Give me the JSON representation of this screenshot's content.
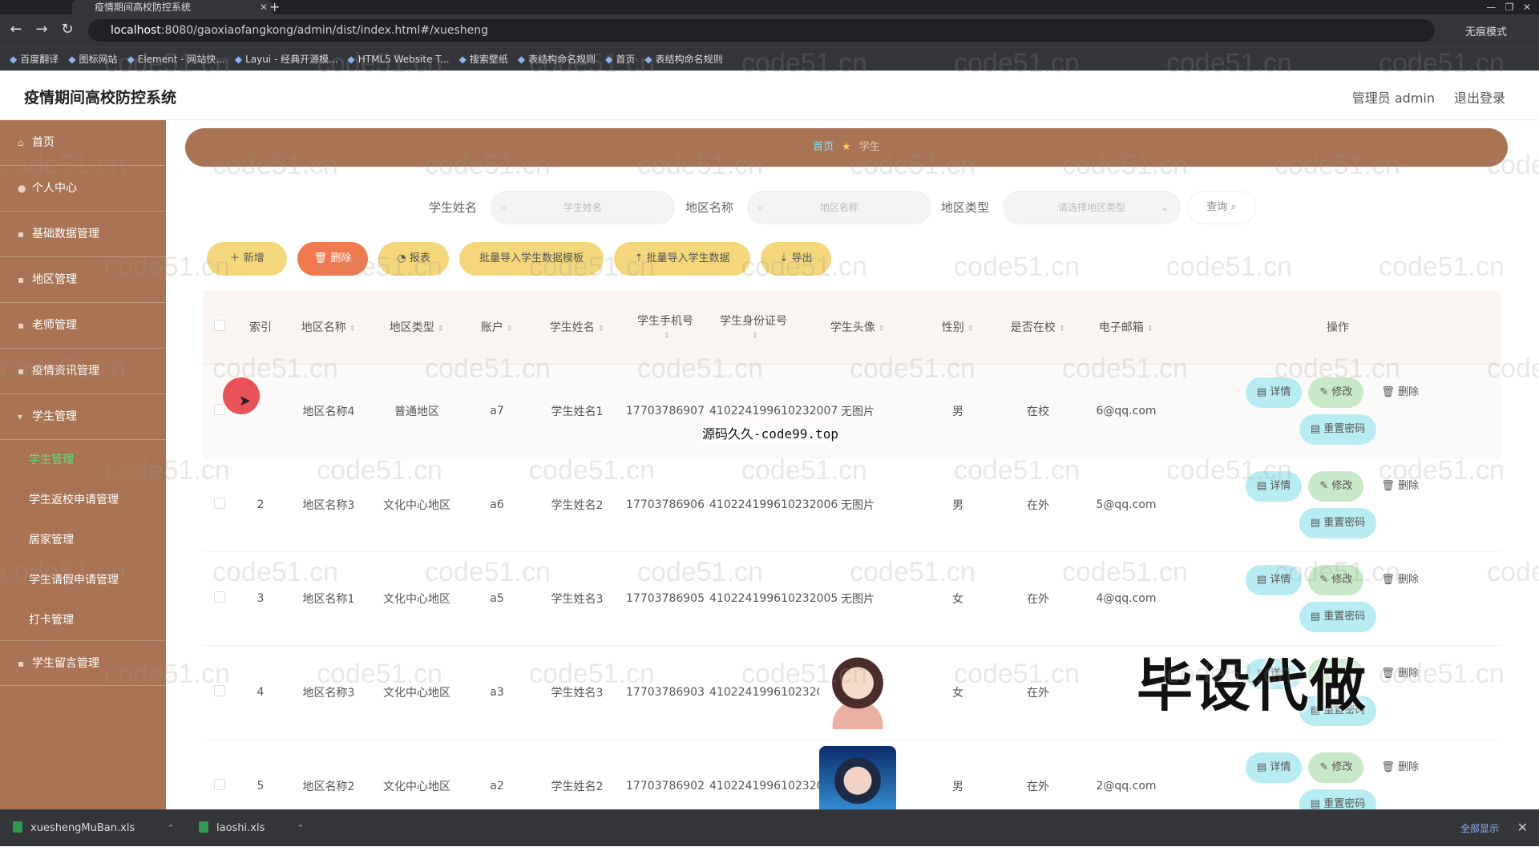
{
  "browser": {
    "tab_title": "疫情期间高校防控系统",
    "url_host": "localhost",
    "url_rest": ":8080/gaoxiaofangkong/admin/dist/index.html#/xuesheng",
    "incognito": "无痕模式",
    "bookmarks": [
      "百度翻译",
      "图标网站",
      "Element - 网站快...",
      "Layui - 经典开源模...",
      "HTML5 Website T...",
      "搜索壁纸",
      "表结构命名规则",
      "首页",
      "表结构命名规则"
    ]
  },
  "header": {
    "title": "疫情期间高校防控系统",
    "admin": "管理员 admin",
    "logout": "退出登录"
  },
  "sidebar": {
    "items": [
      {
        "label": "首页"
      },
      {
        "label": "个人中心"
      },
      {
        "label": "基础数据管理"
      },
      {
        "label": "地区管理"
      },
      {
        "label": "老师管理"
      },
      {
        "label": "疫情资讯管理"
      },
      {
        "label": "学生管理"
      }
    ],
    "sub_items": [
      {
        "label": "学生管理"
      },
      {
        "label": "学生返校申请管理"
      },
      {
        "label": "居家管理"
      },
      {
        "label": "学生请假申请管理"
      },
      {
        "label": "打卡管理"
      }
    ],
    "last_item": {
      "label": "学生留言管理"
    }
  },
  "breadcrumb": {
    "home": "首页",
    "current": "学生"
  },
  "search": {
    "name_label": "学生姓名",
    "name_placeholder": "学生姓名",
    "area_label": "地区名称",
    "area_placeholder": "地区名称",
    "type_label": "地区类型",
    "type_placeholder": "请选择地区类型",
    "query": "查询"
  },
  "toolbar": {
    "add": "新增",
    "delete": "删除",
    "report": "报表",
    "import_template": "批量导入学生数据模板",
    "import_data": "批量导入学生数据",
    "export": "导出"
  },
  "table": {
    "headers": [
      "索引",
      "地区名称",
      "地区类型",
      "账户",
      "学生姓名",
      "学生手机号",
      "学生身份证号",
      "学生头像",
      "性别",
      "是否在校",
      "电子邮箱",
      "操作"
    ],
    "actions": {
      "detail": "详情",
      "edit": "修改",
      "delete": "删除",
      "reset": "重置密码"
    },
    "rows": [
      {
        "index": "",
        "area": "地区名称4",
        "type": "普通地区",
        "account": "a7",
        "name": "学生姓名1",
        "phone": "17703786907",
        "idno": "410224199610232007",
        "avatar": "无图片",
        "gender": "男",
        "inschool": "在校",
        "email": "6@qq.com"
      },
      {
        "index": "2",
        "area": "地区名称3",
        "type": "文化中心地区",
        "account": "a6",
        "name": "学生姓名2",
        "phone": "17703786906",
        "idno": "410224199610232006",
        "avatar": "无图片",
        "gender": "男",
        "inschool": "在外",
        "email": "5@qq.com"
      },
      {
        "index": "3",
        "area": "地区名称1",
        "type": "文化中心地区",
        "account": "a5",
        "name": "学生姓名3",
        "phone": "17703786905",
        "idno": "410224199610232005",
        "avatar": "无图片",
        "gender": "女",
        "inschool": "在外",
        "email": "4@qq.com"
      },
      {
        "index": "4",
        "area": "地区名称3",
        "type": "文化中心地区",
        "account": "a3",
        "name": "学生姓名3",
        "phone": "17703786903",
        "idno": "410224199610232003",
        "avatar": "",
        "gender": "女",
        "inschool": "在外",
        "email": ""
      },
      {
        "index": "5",
        "area": "地区名称2",
        "type": "文化中心地区",
        "account": "a2",
        "name": "学生姓名2",
        "phone": "17703786902",
        "idno": "410224199610232002",
        "avatar": "",
        "gender": "男",
        "inschool": "在外",
        "email": "2@qq.com"
      }
    ]
  },
  "overlays": {
    "code_text": "源码久久-code99.top",
    "big_text": "毕设代做",
    "watermark": "code51.cn"
  },
  "downloads": {
    "file1": "xueshengMuBan.xls",
    "file2": "laoshi.xls",
    "show_all": "全部显示"
  }
}
